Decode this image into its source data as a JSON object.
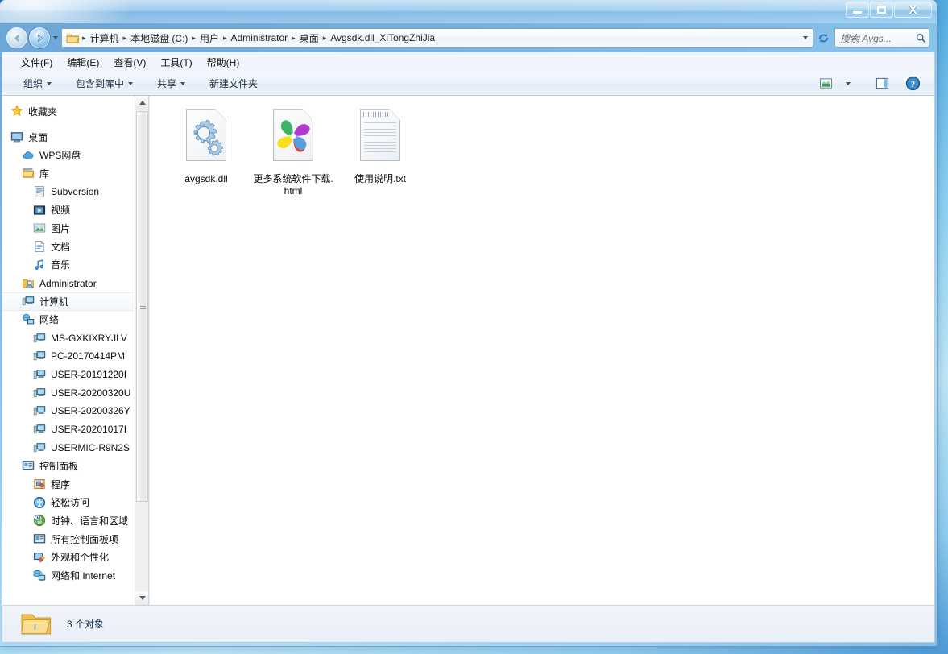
{
  "window": {
    "title": "",
    "controls": {
      "minimize": "–",
      "maximize": "□",
      "close": "X"
    }
  },
  "nav": {
    "back_tooltip": "后退",
    "forward_tooltip": "前进",
    "history_tooltip": "最近的页面"
  },
  "address": {
    "crumbs": [
      "计算机",
      "本地磁盘 (C:)",
      "用户",
      "Administrator",
      "桌面",
      "Avgsdk.dll_XiTongZhiJia"
    ],
    "separator": "▸",
    "refresh_glyph": "↻"
  },
  "search": {
    "placeholder": "搜索 Avgs...",
    "icon": "search-icon"
  },
  "menubar": {
    "items": [
      "文件(F)",
      "编辑(E)",
      "查看(V)",
      "工具(T)",
      "帮助(H)"
    ]
  },
  "commandbar": {
    "items": [
      {
        "label": "组织",
        "has_caret": true
      },
      {
        "label": "包含到库中",
        "has_caret": true
      },
      {
        "label": "共享",
        "has_caret": true
      },
      {
        "label": "新建文件夹",
        "has_caret": false
      }
    ],
    "right_icons": [
      {
        "name": "change-view-icon",
        "caret": true
      },
      {
        "name": "preview-pane-icon",
        "caret": false
      },
      {
        "name": "help-icon",
        "caret": false
      }
    ]
  },
  "sidebar": {
    "items": [
      {
        "label": "收藏夹",
        "icon": "star-icon",
        "indent": 0,
        "selected": false,
        "gap_after": true
      },
      {
        "label": "桌面",
        "icon": "desktop-icon",
        "indent": 0,
        "selected": false
      },
      {
        "label": "WPS网盘",
        "icon": "cloud-icon",
        "indent": 1,
        "selected": false
      },
      {
        "label": "库",
        "icon": "library-icon",
        "indent": 1,
        "selected": false
      },
      {
        "label": "Subversion",
        "icon": "subversion-icon",
        "indent": 2,
        "selected": false
      },
      {
        "label": "视频",
        "icon": "video-icon",
        "indent": 2,
        "selected": false
      },
      {
        "label": "图片",
        "icon": "picture-icon",
        "indent": 2,
        "selected": false
      },
      {
        "label": "文档",
        "icon": "document-icon",
        "indent": 2,
        "selected": false
      },
      {
        "label": "音乐",
        "icon": "music-icon",
        "indent": 2,
        "selected": false
      },
      {
        "label": "Administrator",
        "icon": "user-icon",
        "indent": 1,
        "selected": false
      },
      {
        "label": "计算机",
        "icon": "computer-icon",
        "indent": 1,
        "selected": true
      },
      {
        "label": "网络",
        "icon": "network-icon",
        "indent": 1,
        "selected": false
      },
      {
        "label": "MS-GXKIXRYJLV",
        "icon": "computer-icon",
        "indent": 2,
        "selected": false
      },
      {
        "label": "PC-20170414PM",
        "icon": "computer-icon",
        "indent": 2,
        "selected": false
      },
      {
        "label": "USER-20191220I",
        "icon": "computer-icon",
        "indent": 2,
        "selected": false
      },
      {
        "label": "USER-20200320U",
        "icon": "computer-icon",
        "indent": 2,
        "selected": false
      },
      {
        "label": "USER-20200326Y",
        "icon": "computer-icon",
        "indent": 2,
        "selected": false
      },
      {
        "label": "USER-20201017I",
        "icon": "computer-icon",
        "indent": 2,
        "selected": false
      },
      {
        "label": "USERMIC-R9N2S",
        "icon": "computer-icon",
        "indent": 2,
        "selected": false
      },
      {
        "label": "控制面板",
        "icon": "control-panel-icon",
        "indent": 1,
        "selected": false
      },
      {
        "label": "程序",
        "icon": "programs-icon",
        "indent": 2,
        "selected": false
      },
      {
        "label": "轻松访问",
        "icon": "ease-of-access-icon",
        "indent": 2,
        "selected": false
      },
      {
        "label": "时钟、语言和区域",
        "icon": "clock-region-icon",
        "indent": 2,
        "selected": false
      },
      {
        "label": "所有控制面板项",
        "icon": "control-panel-icon",
        "indent": 2,
        "selected": false
      },
      {
        "label": "外观和个性化",
        "icon": "appearance-icon",
        "indent": 2,
        "selected": false
      },
      {
        "label": "网络和 Internet",
        "icon": "network-internet-icon",
        "indent": 2,
        "selected": false
      }
    ]
  },
  "files": [
    {
      "name": "avgsdk.dll",
      "icon": "dll-gear-icon"
    },
    {
      "name": "更多系统软件下载.html",
      "icon": "html-pinwheel-icon"
    },
    {
      "name": "使用说明.txt",
      "icon": "text-file-icon"
    }
  ],
  "statusbar": {
    "text": "3 个对象",
    "icon": "folder-icon"
  },
  "colors": {
    "accent": "#1a6cb5",
    "window_bg": "#ffffff",
    "chrome": "#eaf1f9",
    "selection": "#f2f6fb"
  }
}
